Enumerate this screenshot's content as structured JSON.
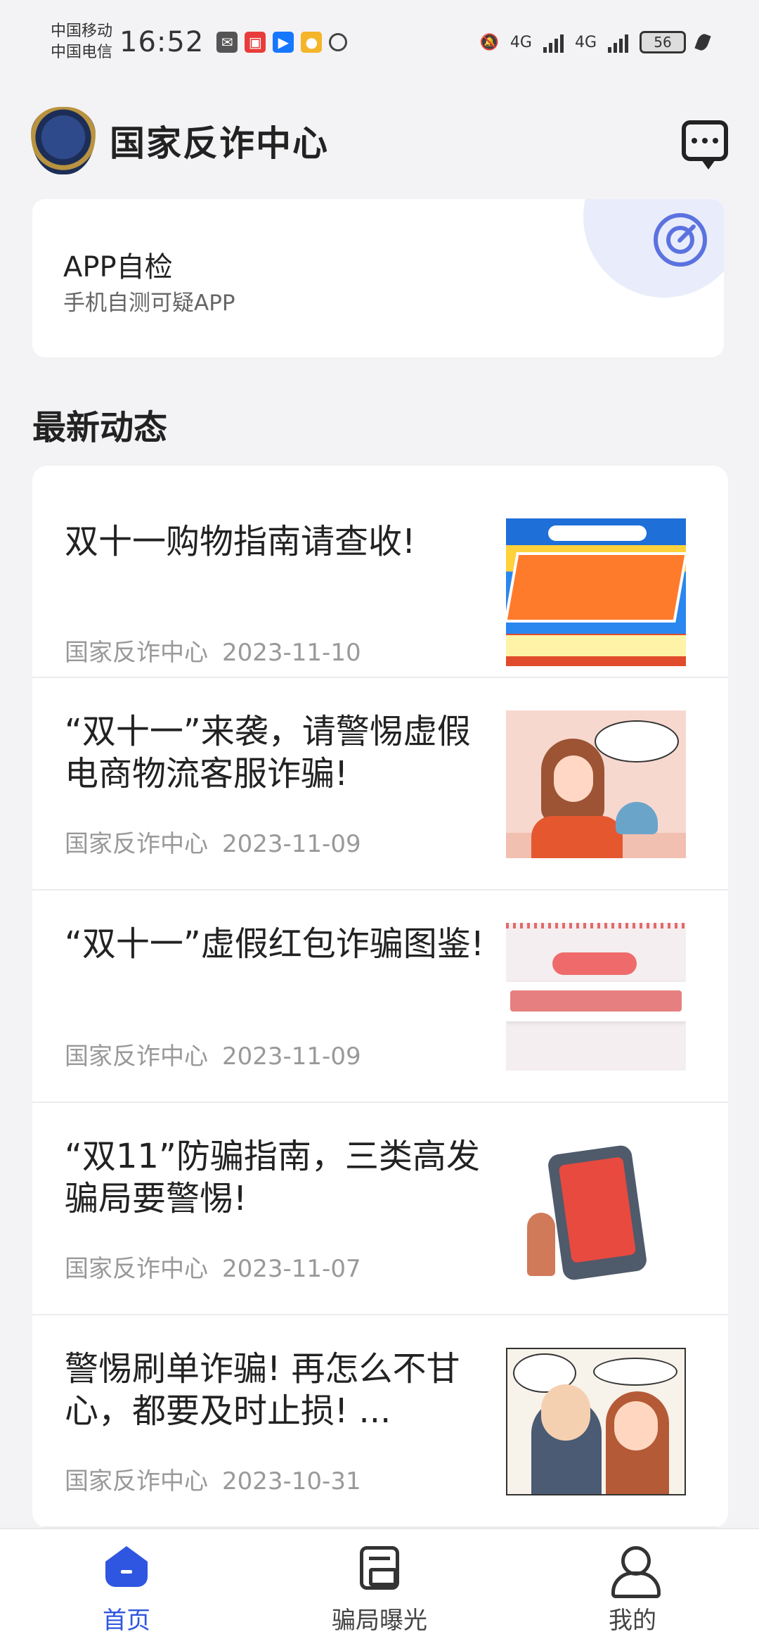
{
  "status_bar": {
    "carrier_1": "中国移动",
    "carrier_2": "中国电信",
    "time": "16:52",
    "network_1": "4G",
    "network_2": "4G",
    "battery": "56"
  },
  "header": {
    "title": "国家反诈中心",
    "logo_icon": "shield-badge-icon",
    "message_icon": "message-bubble-icon"
  },
  "app_check": {
    "title": "APP自检",
    "subtitle": "手机自测可疑APP",
    "icon": "target-icon",
    "accent": "#5b72e0"
  },
  "section": {
    "title": "最新动态"
  },
  "news": [
    {
      "title": "双十一购物指南请查收!",
      "source": "国家反诈中心",
      "date": "2023-11-10"
    },
    {
      "title": "“双十一”来袭，请警惕虚假电商物流客服诈骗!",
      "source": "国家反诈中心",
      "date": "2023-11-09"
    },
    {
      "title": "“双十一”虚假红包诈骗图鉴!",
      "source": "国家反诈中心",
      "date": "2023-11-09"
    },
    {
      "title": "“双11”防骗指南，三类高发骗局要警惕!",
      "source": "国家反诈中心",
      "date": "2023-11-07"
    },
    {
      "title": "警惕刷单诈骗! 再怎么不甘心，都要及时止损! ...",
      "source": "国家反诈中心",
      "date": "2023-10-31"
    }
  ],
  "bottom_nav": {
    "home": "首页",
    "expose": "骗局曝光",
    "me": "我的",
    "active_color": "#2f56e0"
  }
}
